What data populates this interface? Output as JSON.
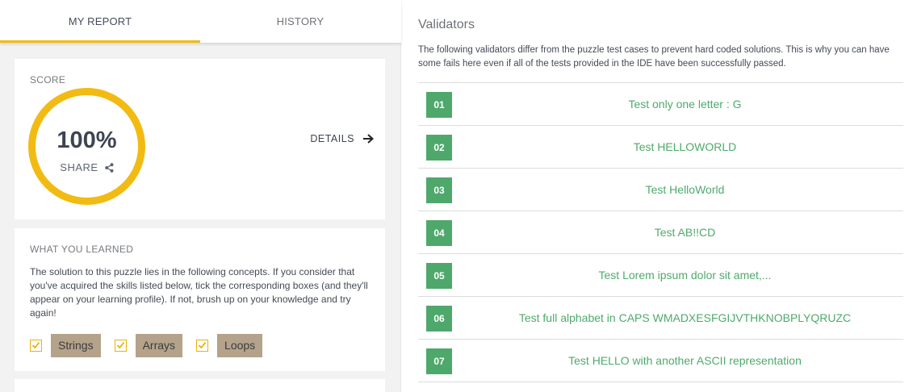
{
  "tabs": [
    {
      "label": "MY REPORT",
      "active": true
    },
    {
      "label": "HISTORY",
      "active": false
    }
  ],
  "score": {
    "title": "SCORE",
    "value": "100%",
    "share_label": "SHARE",
    "details_label": "DETAILS",
    "ring_color": "#f2bb13"
  },
  "learned": {
    "title": "WHAT YOU LEARNED",
    "description": "The solution to this puzzle lies in the following concepts. If you consider that you've acquired the skills listed below, tick the corresponding boxes (and they'll appear on your learning profile). If not, brush up on your knowledge and try again!",
    "skills": [
      {
        "label": "Strings",
        "checked": true
      },
      {
        "label": "Arrays",
        "checked": true
      },
      {
        "label": "Loops",
        "checked": true
      }
    ]
  },
  "validators": {
    "title": "Validators",
    "description": "The following validators differ from the puzzle test cases to prevent hard coded solutions. This is why you can have some fails here even if all of the tests provided in the IDE have been successfully passed.",
    "items": [
      {
        "num": "01",
        "name": "Test only one letter : G"
      },
      {
        "num": "02",
        "name": "Test HELLOWORLD"
      },
      {
        "num": "03",
        "name": "Test HelloWorld"
      },
      {
        "num": "04",
        "name": "Test AB!!CD"
      },
      {
        "num": "05",
        "name": "Test Lorem ipsum dolor sit amet,..."
      },
      {
        "num": "06",
        "name": "Test full alphabet in CAPS WMADXESFGIJVTHKNOBPLYQRUZC"
      },
      {
        "num": "07",
        "name": "Test HELLO with another ASCII representation"
      }
    ],
    "pass_color": "#4ea86b"
  }
}
